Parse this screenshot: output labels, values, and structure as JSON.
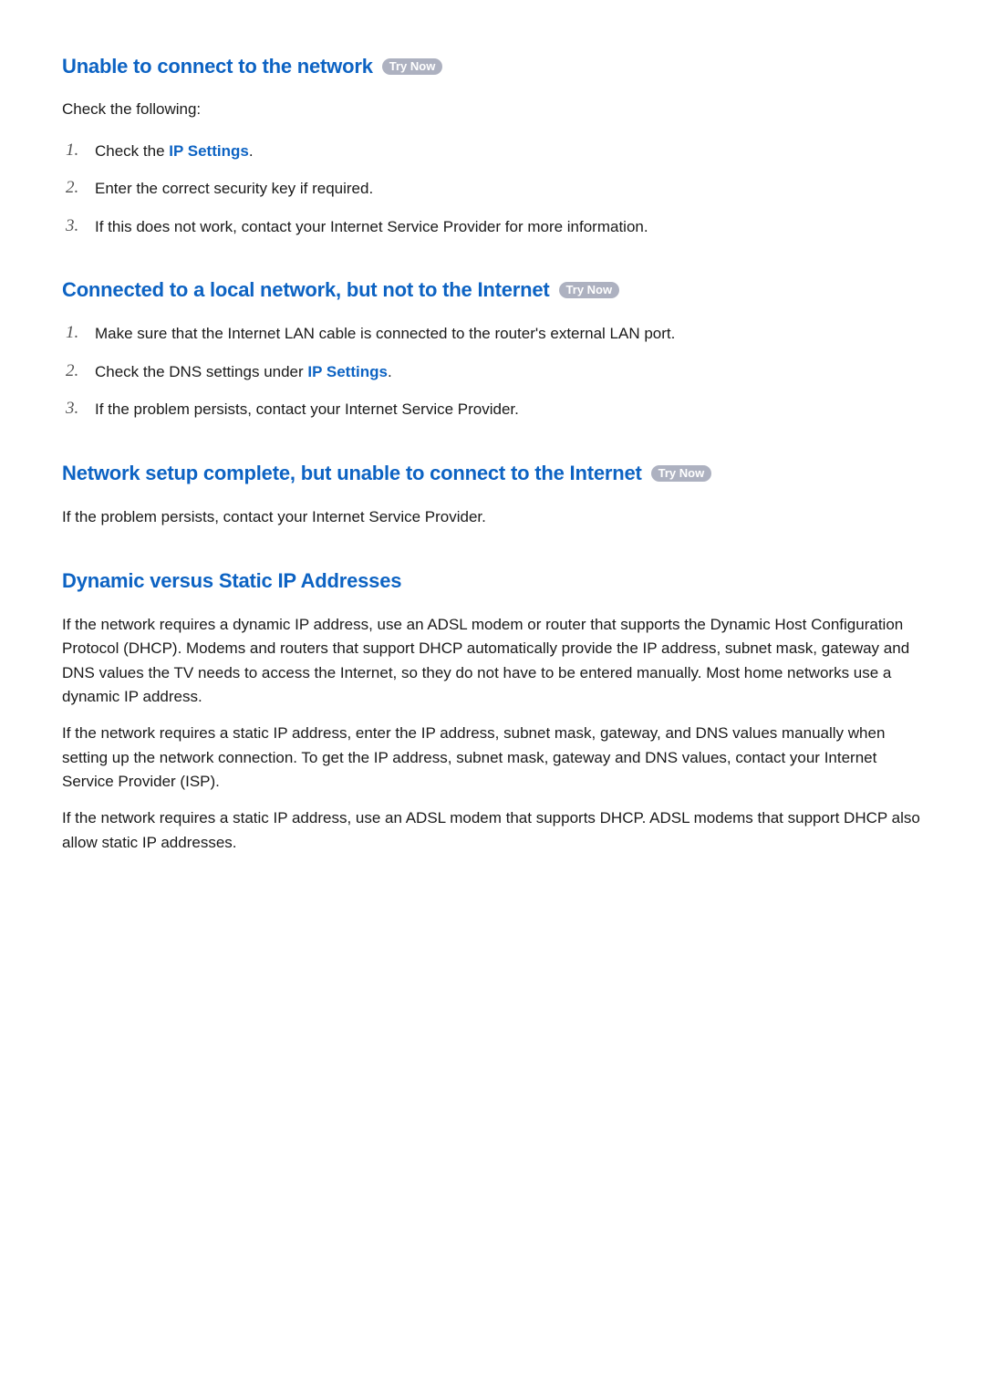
{
  "badge_label": "Try Now",
  "sections": [
    {
      "title": "Unable to connect to the network",
      "has_badge": true,
      "lead": "Check the following:",
      "list": [
        {
          "pre": "Check the ",
          "term": "IP Settings",
          "post": "."
        },
        {
          "pre": "Enter the correct security key if required.",
          "term": "",
          "post": ""
        },
        {
          "pre": "If this does not work, contact your Internet Service Provider for more information.",
          "term": "",
          "post": ""
        }
      ]
    },
    {
      "title": "Connected to a local network, but not to the Internet",
      "has_badge": true,
      "list": [
        {
          "pre": "Make sure that the Internet LAN cable is connected to the router's external LAN port.",
          "term": "",
          "post": ""
        },
        {
          "pre": "Check the DNS settings under ",
          "term": "IP Settings",
          "post": "."
        },
        {
          "pre": "If the problem persists, contact your Internet Service Provider.",
          "term": "",
          "post": ""
        }
      ]
    },
    {
      "title": "Network setup complete, but unable to connect to the Internet",
      "has_badge": true,
      "paragraphs": [
        "If the problem persists, contact your Internet Service Provider."
      ]
    },
    {
      "title": "Dynamic versus Static IP Addresses",
      "has_badge": false,
      "paragraphs": [
        "If the network requires a dynamic IP address, use an ADSL modem or router that supports the Dynamic Host Configuration Protocol (DHCP). Modems and routers that support DHCP automatically provide the IP address, subnet mask, gateway and DNS values the TV needs to access the Internet, so they do not have to be entered manually. Most home networks use a dynamic IP address.",
        "If the network requires a static IP address, enter the IP address, subnet mask, gateway, and DNS values manually when setting up the network connection. To get the IP address, subnet mask, gateway and DNS values, contact your Internet Service Provider (ISP).",
        "If the network requires a static IP address, use an ADSL modem that supports DHCP. ADSL modems that support DHCP also allow static IP addresses."
      ]
    }
  ]
}
